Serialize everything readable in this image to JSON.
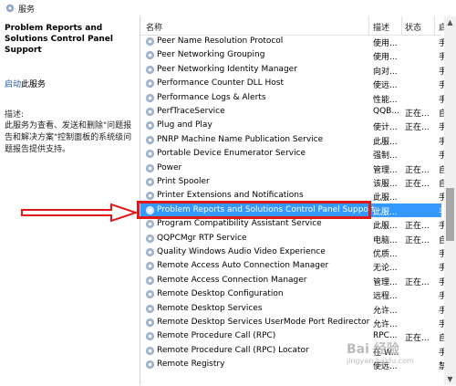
{
  "window": {
    "title": "服务"
  },
  "left_pane": {
    "service_title": "Problem Reports and Solutions Control Panel Support",
    "start_link": "启动",
    "start_suffix": "此服务",
    "desc_label": "描述:",
    "description": "此服务为查看、发送和删除\"问题报告和解决方案\"控制面板的系统级问题报告提供支持。"
  },
  "columns": {
    "name": "名称",
    "description": "描述",
    "status": "状态",
    "startup": "启"
  },
  "rows": [
    {
      "name": "Peer Name Resolution Protocol",
      "desc": "使用...",
      "status": "",
      "startup": "手"
    },
    {
      "name": "Peer Networking Grouping",
      "desc": "使用...",
      "status": "",
      "startup": "手"
    },
    {
      "name": "Peer Networking Identity Manager",
      "desc": "向对...",
      "status": "",
      "startup": "手"
    },
    {
      "name": "Performance Counter DLL Host",
      "desc": "使远...",
      "status": "",
      "startup": "手"
    },
    {
      "name": "Performance Logs & Alerts",
      "desc": "性能...",
      "status": "",
      "startup": "手"
    },
    {
      "name": "PerfTraceService",
      "desc": "QQB...",
      "status": "正在...",
      "startup": "自"
    },
    {
      "name": "Plug and Play",
      "desc": "使计...",
      "status": "正在...",
      "startup": "手"
    },
    {
      "name": "PNRP Machine Name Publication Service",
      "desc": "此服...",
      "status": "",
      "startup": "手"
    },
    {
      "name": "Portable Device Enumerator Service",
      "desc": "强制...",
      "status": "",
      "startup": "手"
    },
    {
      "name": "Power",
      "desc": "管理...",
      "status": "正在...",
      "startup": "自"
    },
    {
      "name": "Print Spooler",
      "desc": "该服...",
      "status": "正在...",
      "startup": "自"
    },
    {
      "name": "Printer Extensions and Notifications",
      "desc": "此服...",
      "status": "",
      "startup": "手"
    },
    {
      "name": "Problem Reports and Solutions Control Panel Support",
      "desc": "此服...",
      "status": "",
      "startup": "手",
      "selected": "true"
    },
    {
      "name": "Program Compatibility Assistant Service",
      "desc": "此服...",
      "status": "正在...",
      "startup": "手"
    },
    {
      "name": "QQPCMgr RTP Service",
      "desc": "电脑...",
      "status": "正在...",
      "startup": "自"
    },
    {
      "name": "Quality Windows Audio Video Experience",
      "desc": "优质...",
      "status": "",
      "startup": "手"
    },
    {
      "name": "Remote Access Auto Connection Manager",
      "desc": "无论...",
      "status": "",
      "startup": "手"
    },
    {
      "name": "Remote Access Connection Manager",
      "desc": "管理...",
      "status": "正在...",
      "startup": "手"
    },
    {
      "name": "Remote Desktop Configuration",
      "desc": "远程...",
      "status": "",
      "startup": "手"
    },
    {
      "name": "Remote Desktop Services",
      "desc": "允许...",
      "status": "",
      "startup": "手"
    },
    {
      "name": "Remote Desktop Services UserMode Port Redirector",
      "desc": "允许...",
      "status": "",
      "startup": "手"
    },
    {
      "name": "Remote Procedure Call (RPC)",
      "desc": "RPC...",
      "status": "正在...",
      "startup": "自"
    },
    {
      "name": "Remote Procedure Call (RPC) Locator",
      "desc": "在 W...",
      "status": "",
      "startup": "手"
    },
    {
      "name": "Remote Registry",
      "desc": "使远...",
      "status": "",
      "startup": "禁"
    },
    {
      "name": "",
      "desc": "",
      "status": "",
      "startup": ""
    }
  ],
  "watermark": {
    "main": "Bai 经验",
    "sub": "jingyan.baidu.com"
  },
  "colors": {
    "selection": "#3399ff",
    "highlight_box": "#e01818",
    "arrow": "#e01818"
  }
}
